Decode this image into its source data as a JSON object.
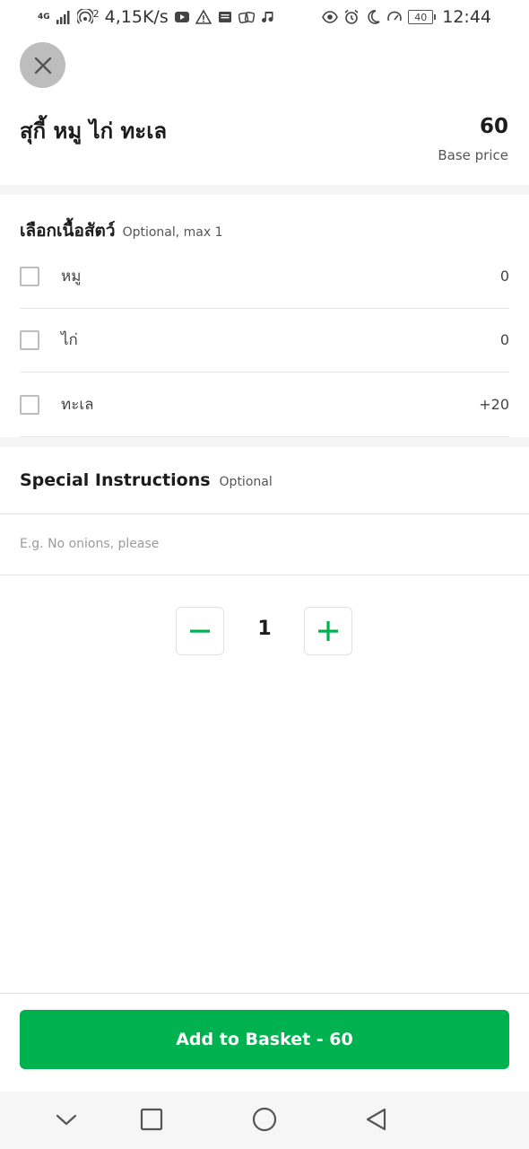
{
  "status_bar": {
    "network_type": "4G",
    "hotspot_count": "2",
    "speed": "4,15K/s",
    "battery": "40",
    "time": "12:44"
  },
  "header": {
    "close_icon": "close-icon",
    "title": "สุกี้ หมู ไก่ ทะเล",
    "price": "60",
    "price_caption": "Base price"
  },
  "options_section": {
    "title": "เลือกเนื้อสัตว์",
    "subtitle": "Optional, max 1",
    "options": [
      {
        "label": "หมู",
        "price": "0",
        "checked": false
      },
      {
        "label": "ไก่",
        "price": "0",
        "checked": false
      },
      {
        "label": "ทะเล",
        "price": "+20",
        "checked": false
      }
    ]
  },
  "special_instructions": {
    "title": "Special Instructions",
    "subtitle": "Optional",
    "placeholder": "E.g. No onions, please",
    "value": ""
  },
  "quantity": {
    "value": "1",
    "minus_icon": "minus-icon",
    "plus_icon": "plus-icon"
  },
  "footer": {
    "add_button_label": "Add to Basket - 60"
  },
  "nav_bar": {
    "icons": [
      "chevron-down-icon",
      "square-icon",
      "circle-icon",
      "back-triangle-icon"
    ]
  },
  "colors": {
    "accent": "#00b14f",
    "close_button": "#bdbdbd"
  }
}
